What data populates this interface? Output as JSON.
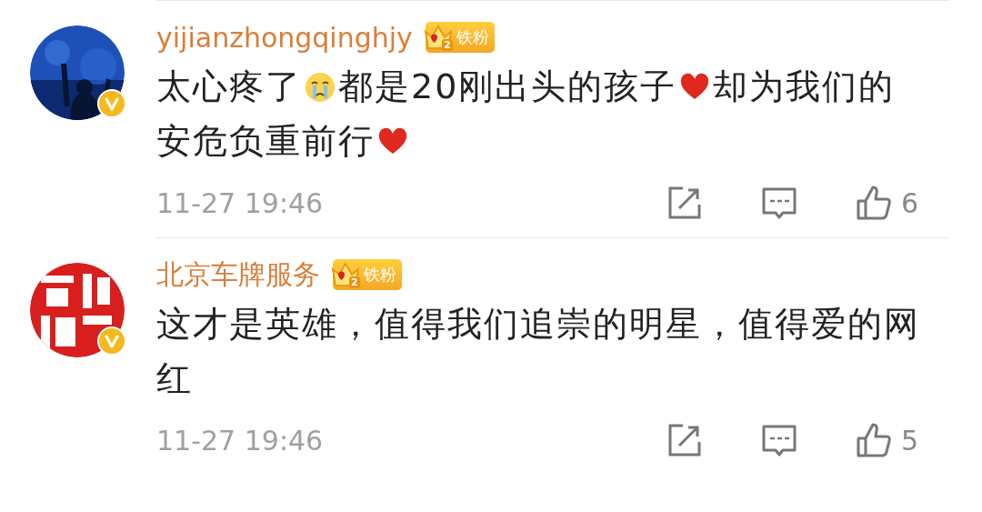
{
  "comments": [
    {
      "avatar": {
        "kind": "picture",
        "color": "#1f50b8"
      },
      "verified": true,
      "name": "yijianzhongqinghjy",
      "badge": {
        "rank": "2",
        "label": "铁粉"
      },
      "content": [
        {
          "kind": "text",
          "text": "太心疼了"
        },
        {
          "kind": "crying"
        },
        {
          "kind": "text",
          "text": "都是20刚出头的孩子"
        },
        {
          "kind": "heart"
        },
        {
          "kind": "text",
          "text": "却为我们的安危负重前行"
        },
        {
          "kind": "heart"
        }
      ],
      "time": "11-27 19:46",
      "likes": "6"
    },
    {
      "avatar": {
        "kind": "picture",
        "color": "#d91e1e"
      },
      "verified": true,
      "name": "北京车牌服务",
      "badge": {
        "rank": "2",
        "label": "铁粉"
      },
      "content": [
        {
          "kind": "text",
          "text": "这才是英雄，值得我们追崇的明星，值得爱的网红"
        }
      ],
      "time": "11-27 19:46",
      "likes": "5"
    }
  ]
}
